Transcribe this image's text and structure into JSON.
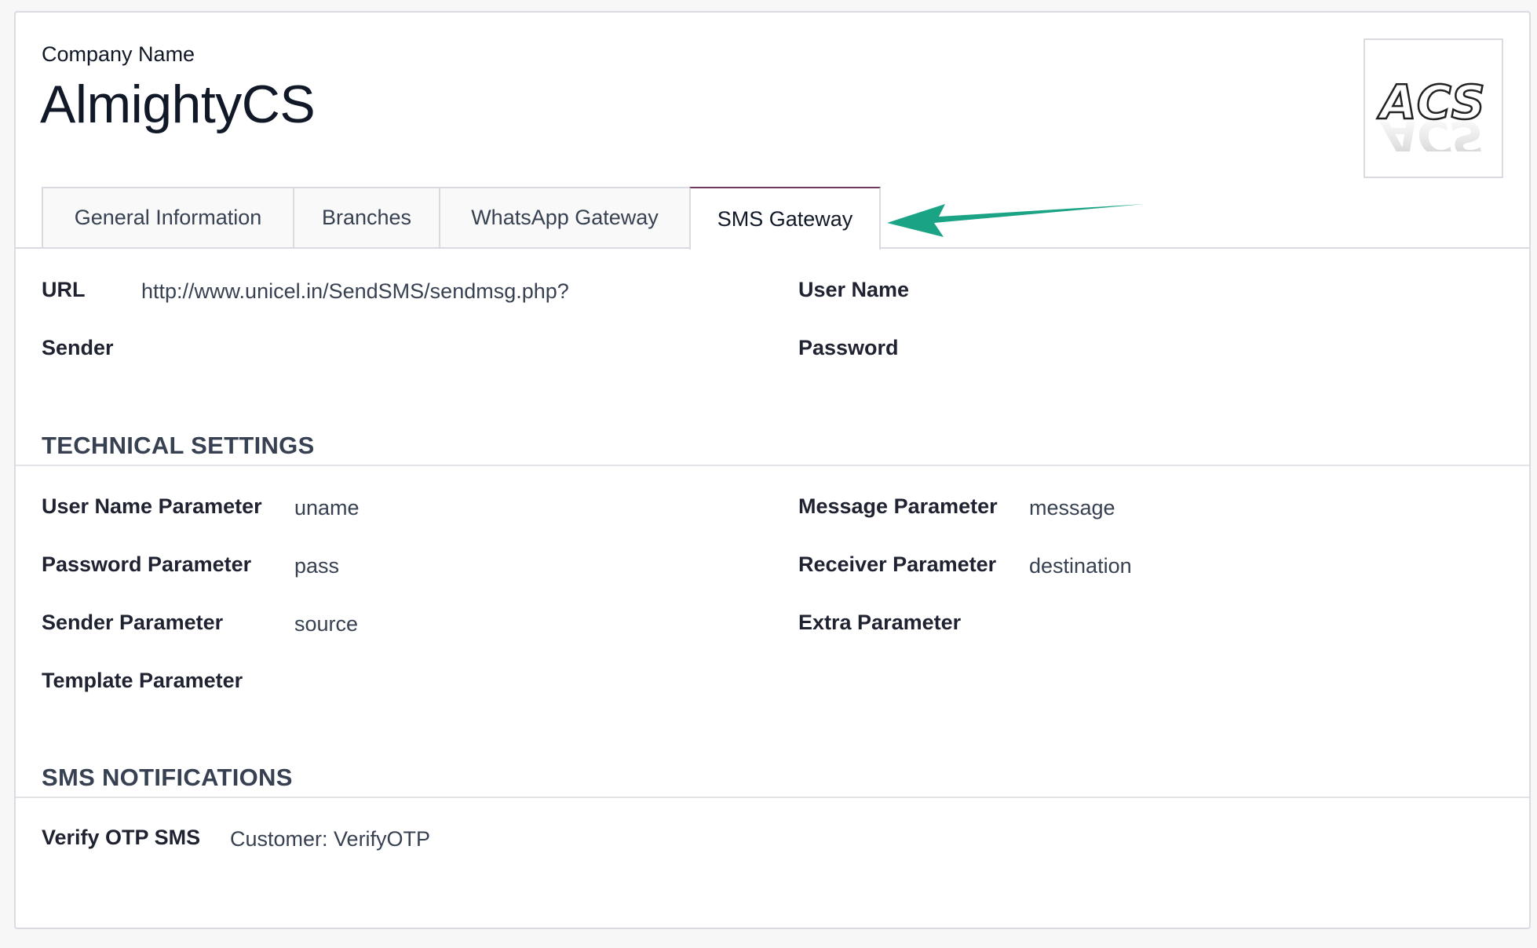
{
  "header": {
    "company_label": "Company Name",
    "company_name": "AlmightyCS",
    "logo_text": "ACS"
  },
  "tabs": [
    {
      "label": "General Information",
      "active": false
    },
    {
      "label": "Branches",
      "active": false
    },
    {
      "label": "WhatsApp Gateway",
      "active": false
    },
    {
      "label": "SMS Gateway",
      "active": true
    }
  ],
  "gateway": {
    "url_label": "URL",
    "url_value": "http://www.unicel.in/SendSMS/sendmsg.php?",
    "username_label": "User Name",
    "sender_label": "Sender",
    "password_label": "Password"
  },
  "technical": {
    "title": "TECHNICAL SETTINGS",
    "username_param_label": "User Name Parameter",
    "username_param_value": "uname",
    "password_param_label": "Password Parameter",
    "password_param_value": "pass",
    "sender_param_label": "Sender Parameter",
    "sender_param_value": "source",
    "template_param_label": "Template Parameter",
    "message_param_label": "Message Parameter",
    "message_param_value": "message",
    "receiver_param_label": "Receiver Parameter",
    "receiver_param_value": "destination",
    "extra_param_label": "Extra Parameter"
  },
  "notifications": {
    "title": "SMS NOTIFICATIONS",
    "verify_otp_label": "Verify OTP SMS",
    "verify_otp_value": "Customer: VerifyOTP"
  },
  "colors": {
    "active_tab_accent": "#71395e",
    "annotation_arrow": "#1aa385"
  },
  "icons": {
    "annotation": "arrow-left-icon"
  }
}
